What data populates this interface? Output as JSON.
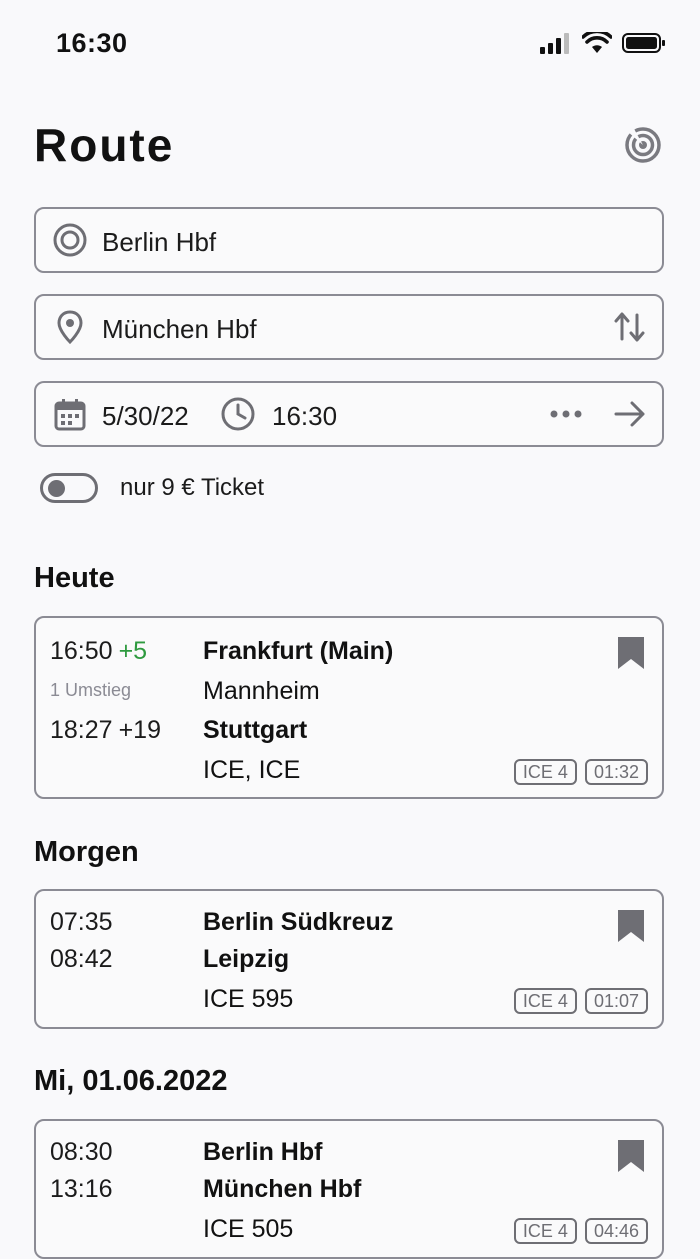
{
  "status": {
    "time": "16:30"
  },
  "header": {
    "title": "Route"
  },
  "search": {
    "from": "Berlin Hbf",
    "to": "München Hbf",
    "date": "5/30/22",
    "time": "16:30",
    "nine_euro_label": "nur 9 € Ticket",
    "nine_euro_enabled": false
  },
  "sections": [
    {
      "title": "Heute",
      "trip": {
        "dep": "16:50",
        "dep_delay": "+5",
        "transfers": "1 Umstieg",
        "arr": "18:27",
        "arr_delay": "+19",
        "stop1": "Frankfurt (Main)",
        "stop2": "Mannheim",
        "stop3": "Stuttgart",
        "trains": "ICE, ICE",
        "train_type": "ICE 4",
        "duration": "01:32"
      }
    },
    {
      "title": "Morgen",
      "trip": {
        "dep": "07:35",
        "arr": "08:42",
        "stop1": "Berlin Südkreuz",
        "stop2": "Leipzig",
        "trains": "ICE 595",
        "train_type": "ICE 4",
        "duration": "01:07"
      }
    },
    {
      "title": "Mi, 01.06.2022",
      "trip": {
        "dep": "08:30",
        "arr": "13:16",
        "stop1": "Berlin Hbf",
        "stop2": "München Hbf",
        "trains": "ICE 505",
        "train_type": "ICE 4",
        "duration": "04:46"
      }
    }
  ],
  "colors": {
    "on_time": "#2e9a3f",
    "late": "#dd1f1f",
    "border": "#8b8b94",
    "icon": "#6e6e74"
  }
}
